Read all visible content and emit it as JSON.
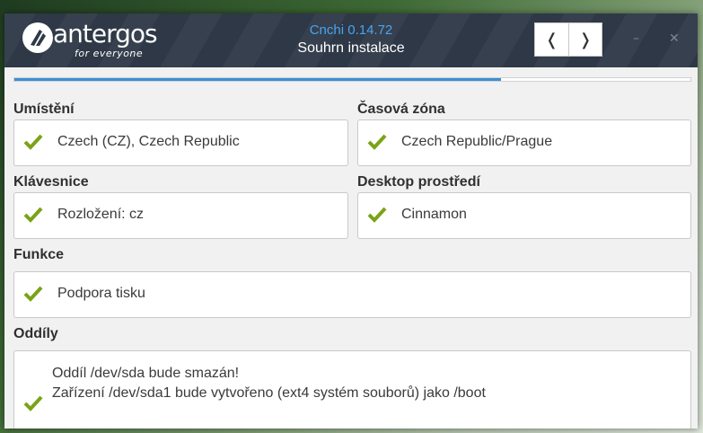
{
  "header": {
    "logo_text": "antergos",
    "logo_sub": "for everyone",
    "app_title": "Cnchi  0.14.72",
    "step_title": "Souhrn instalace",
    "nav_back_glyph": "❬",
    "nav_forward_glyph": "❭",
    "minimize_glyph": "–",
    "close_glyph": "✕"
  },
  "progress": {
    "fraction": 0.72
  },
  "sections": {
    "location": {
      "label": "Umístění",
      "value": "Czech (CZ), Czech Republic"
    },
    "timezone": {
      "label": "Časová zóna",
      "value": "Czech Republic/Prague"
    },
    "keyboard": {
      "label": "Klávesnice",
      "value": "Rozložení: cz"
    },
    "desktop": {
      "label": "Desktop prostředí",
      "value": "Cinnamon"
    },
    "features": {
      "label": "Funkce",
      "value": "Podpora tisku"
    },
    "partitions": {
      "label": "Oddíly",
      "lines": [
        "Oddíl /dev/sda bude smazán!",
        "Zařízení /dev/sda1 bude vytvořeno (ext4 systém souborů) jako /boot"
      ]
    }
  },
  "colors": {
    "accent": "#3a8fd6",
    "check": "#7aa316",
    "header_bg": "#2f3a48"
  },
  "icons": {
    "check": "check-icon",
    "back": "chevron-left-icon",
    "forward": "chevron-right-icon"
  }
}
